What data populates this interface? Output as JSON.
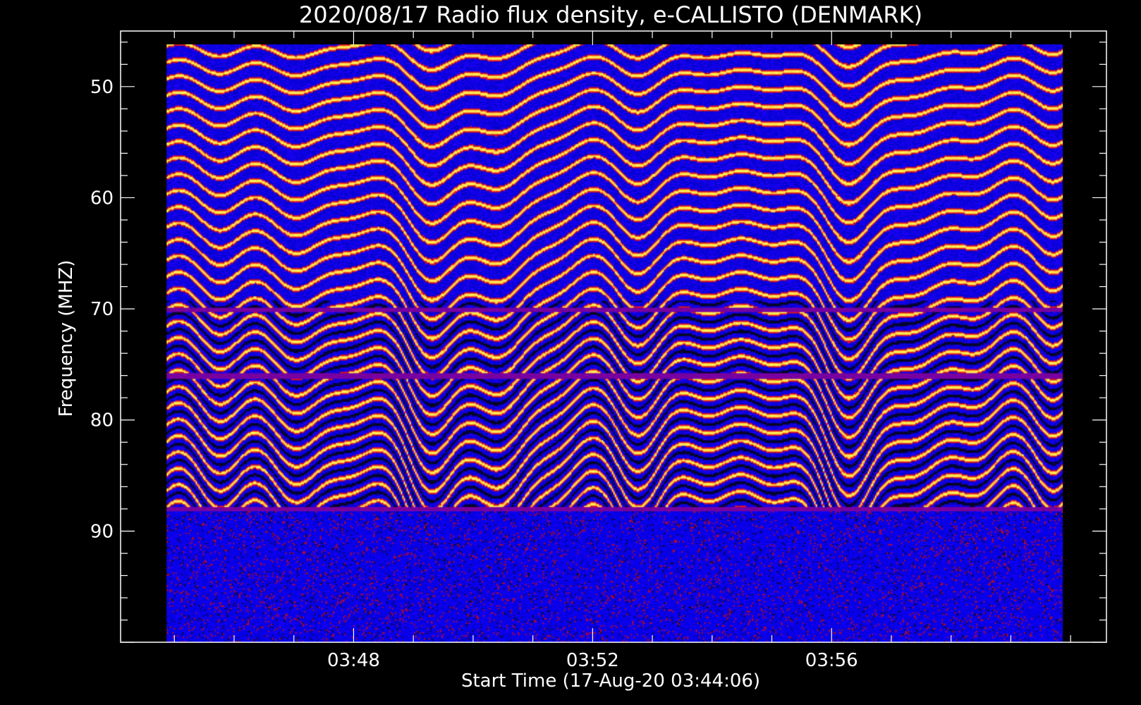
{
  "chart_data": {
    "type": "heatmap",
    "title": "2020/08/17  Radio flux density, e-CALLISTO (DENMARK)",
    "xlabel": "Start Time (17-Aug-20 03:44:06)",
    "ylabel": "Frequency (MHZ)",
    "x_ticks": [
      "03:48",
      "03:52",
      "03:56"
    ],
    "y_ticks": [
      50,
      60,
      70,
      80,
      90
    ],
    "y_inverted": true,
    "xlim_minutes": [
      0.0,
      16.5
    ],
    "ylim_mhz": [
      45.0,
      100.0
    ],
    "data_extent": {
      "time_start_minutes": 0.77,
      "time_end_minutes": 15.77,
      "freq_min_mhz": 46.2,
      "freq_max_mhz": 100.0
    },
    "features": {
      "fringe_band_mhz": [
        46.2,
        88.0
      ],
      "noise_band_mhz": [
        88.0,
        100.0
      ],
      "horizontal_lines_mhz": [
        70.0,
        76.0,
        88.0
      ]
    },
    "colormap": [
      "#0000ff",
      "#000033",
      "#cc0000",
      "#ffff44"
    ],
    "grid": false,
    "legend": "none"
  }
}
